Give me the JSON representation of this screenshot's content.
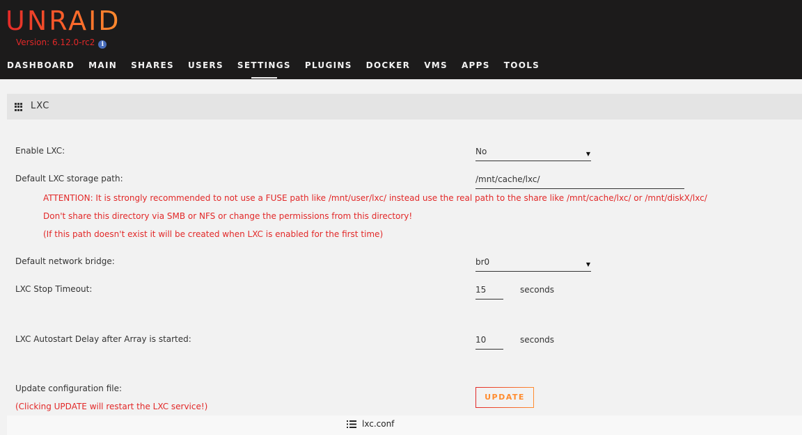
{
  "app": {
    "logo": "UNRAID",
    "version": "Version: 6.12.0-rc2"
  },
  "nav": {
    "items": [
      "DASHBOARD",
      "MAIN",
      "SHARES",
      "USERS",
      "SETTINGS",
      "PLUGINS",
      "DOCKER",
      "VMS",
      "APPS",
      "TOOLS"
    ],
    "active": "SETTINGS"
  },
  "section": {
    "title": "LXC",
    "icon": "grid-icon"
  },
  "form": {
    "enable": {
      "label": "Enable LXC:",
      "value": "No"
    },
    "storage": {
      "label": "Default LXC storage path:",
      "value": "/mnt/cache/lxc/",
      "warnings": [
        "ATTENTION: It is strongly recommended to not use a FUSE path like /mnt/user/lxc/ instead use the real path to the share like /mnt/cache/lxc/ or /mnt/diskX/lxc/",
        "Don't share this directory via SMB or NFS or change the permissions from this directory!",
        "(If this path doesn't exist it will be created when LXC is enabled for the first time)"
      ]
    },
    "bridge": {
      "label": "Default network bridge:",
      "value": "br0"
    },
    "stop_timeout": {
      "label": "LXC Stop Timeout:",
      "value": "15",
      "unit": "seconds"
    },
    "autostart_delay": {
      "label": "LXC Autostart Delay after Array is started:",
      "value": "10",
      "unit": "seconds"
    },
    "update": {
      "label": "Update configuration file:",
      "note": "(Clicking UPDATE will restart the LXC service!)",
      "button": "UPDATE"
    }
  },
  "footer": {
    "file": "lxc.conf",
    "icon": "list-icon"
  },
  "colors": {
    "accent_red": "#e22828",
    "accent_orange": "#ff8c2f",
    "header_bg": "#1c1b1b"
  }
}
